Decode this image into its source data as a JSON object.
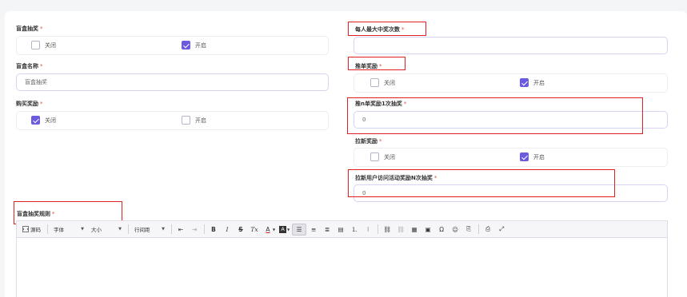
{
  "form": {
    "left": {
      "blindbox_draw": {
        "label": "盲盒抽奖",
        "required": "*",
        "options": [
          {
            "label": "关闭",
            "checked": false
          },
          {
            "label": "开启",
            "checked": true
          }
        ]
      },
      "blindbox_name": {
        "label": "盲盒名称",
        "required": "*",
        "value": "盲盒抽奖"
      },
      "purchase_reward": {
        "label": "购买奖励",
        "required": "*",
        "options": [
          {
            "label": "关闭",
            "checked": true
          },
          {
            "label": "开启",
            "checked": false
          }
        ]
      }
    },
    "right": {
      "max_wins": {
        "label": "每人最大中奖次数",
        "required": "*",
        "value": ""
      },
      "order_reward": {
        "label": "推单奖励",
        "required": "*",
        "options": [
          {
            "label": "关闭",
            "checked": false
          },
          {
            "label": "开启",
            "checked": true
          }
        ]
      },
      "order_n_draw": {
        "label": "推n单奖励1次抽奖",
        "required": "*",
        "value": "0"
      },
      "invite_reward": {
        "label": "拉新奖励",
        "required": "*",
        "options": [
          {
            "label": "关闭",
            "checked": false
          },
          {
            "label": "开启",
            "checked": true
          }
        ]
      },
      "invite_n_draw": {
        "label": "拉新用户访问活动奖励N次抽奖",
        "required": "*",
        "value": "0"
      }
    },
    "rules": {
      "label": "盲盒抽奖规则",
      "required": "*"
    }
  },
  "editor": {
    "source_label": "源码",
    "font_label": "字体",
    "size_label": "大小",
    "line_height_label": "行间距",
    "bold": "B",
    "italic": "I",
    "strike": "S",
    "clear_format": "Tx",
    "font_color": "A",
    "bg_color": "A"
  },
  "colors": {
    "accent": "#6a5ae0",
    "highlight_border": "#e02020",
    "input_border": "#d6d4f3"
  }
}
